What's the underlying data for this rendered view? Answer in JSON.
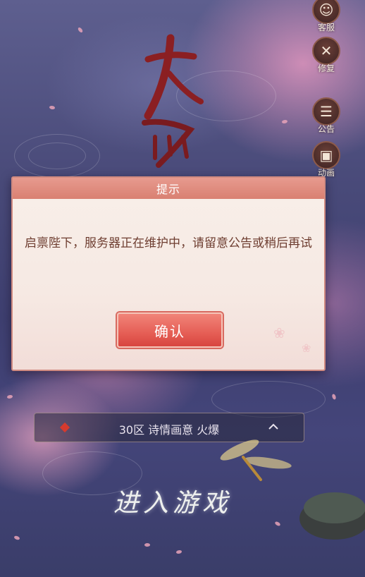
{
  "side_buttons": [
    {
      "icon": "customer-service-icon",
      "label": "客服"
    },
    {
      "icon": "repair-icon",
      "label": "修复"
    },
    {
      "icon": "notice-icon",
      "label": "公告"
    },
    {
      "icon": "animation-icon",
      "label": "动画"
    }
  ],
  "dialog": {
    "title": "提示",
    "message": "启禀陛下，服务器正在维护中，请留意公告或稍后再试",
    "confirm_label": "确认"
  },
  "server": {
    "label": "30区 诗情画意 火爆"
  },
  "enter_game": "进入游戏",
  "colors": {
    "dialog_header": "#d98072",
    "confirm_button": "#e55e55",
    "message_text": "#6e3d30",
    "status_hot": "#d63a2e"
  }
}
